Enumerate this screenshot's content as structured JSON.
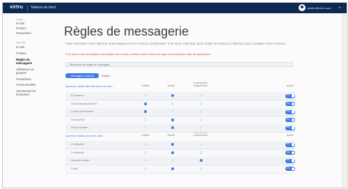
{
  "topbar": {
    "brand": "virtru",
    "title": "Tableau de bord",
    "user": "jweber@virtru.com",
    "chevron": "▾"
  },
  "sidebar": {
    "section1": "Analyse",
    "items1": [
      "E-mail",
      "Fichiers",
      "Paramètres"
    ],
    "section2": "Paramètres",
    "items2": [
      "E-mail",
      "Fichiers",
      "Règles de messagerie",
      "Utilisateurs et groupes",
      "Paramètres",
      "Fonctionnalités",
      "Abonnement et facturation"
    ]
  },
  "main": {
    "title": "Règles de messagerie",
    "description": "Votre extension Virtru détecte automatiquement le contenu confidentiel. Il ne vous reste plus qu'à choisir les actions à effectuer pour protéger votre contenu.",
    "warning": "Pour activer une sauvegarde automatique des e-mails, veuillez activer d'abord la règle correspondante dans les paramètres.",
    "search_placeholder": "Rechercher des règles de messagerie…",
    "search_icon": "search-icon"
  },
  "tabs": [
    {
      "label": "Messages sortants",
      "active": true
    },
    {
      "label": "Entrée",
      "active": false
    }
  ],
  "columns": [
    "Chiffrer",
    "Avertir",
    "Contraindre uniquement",
    "Activé"
  ],
  "sections": [
    {
      "header": "Quand je saisis des éléments de natu…",
      "rows": [
        {
          "label": "ID Amazon",
          "chiffrer": false,
          "avertir": true,
          "contraindre": false,
          "toggle": "ON"
        },
        {
          "label": "Social Security Number",
          "chiffrer": true,
          "avertir": false,
          "contraindre": false,
          "toggle": "ON"
        },
        {
          "label": "Credit Card Number",
          "chiffrer": true,
          "avertir": false,
          "contraindre": false,
          "toggle": "ON"
        },
        {
          "label": "Federal EIN",
          "chiffrer": false,
          "avertir": true,
          "contraindre": false,
          "toggle": "ON"
        },
        {
          "label": "Phone Number",
          "chiffrer": false,
          "avertir": true,
          "contraindre": false,
          "toggle": "ON"
        }
      ]
    },
    {
      "header": "Quand je saisis ces mots-clés…",
      "rows": [
        {
          "label": "Confidentiel",
          "chiffrer": false,
          "avertir": true,
          "contraindre": false,
          "toggle": "ON"
        },
        {
          "label": "Confidentiel",
          "chiffrer": false,
          "avertir": true,
          "contraindre": false,
          "toggle": "ON"
        },
        {
          "label": "Account Number",
          "chiffrer": false,
          "avertir": false,
          "contraindre": true,
          "toggle": "ON"
        },
        {
          "label": "Crédit",
          "chiffrer": false,
          "avertir": true,
          "contraindre": false,
          "toggle": "ON"
        }
      ]
    }
  ],
  "colors": {
    "accent": "#3f7be0",
    "topbar": "#0c2a53",
    "warning": "#d84a3a"
  }
}
